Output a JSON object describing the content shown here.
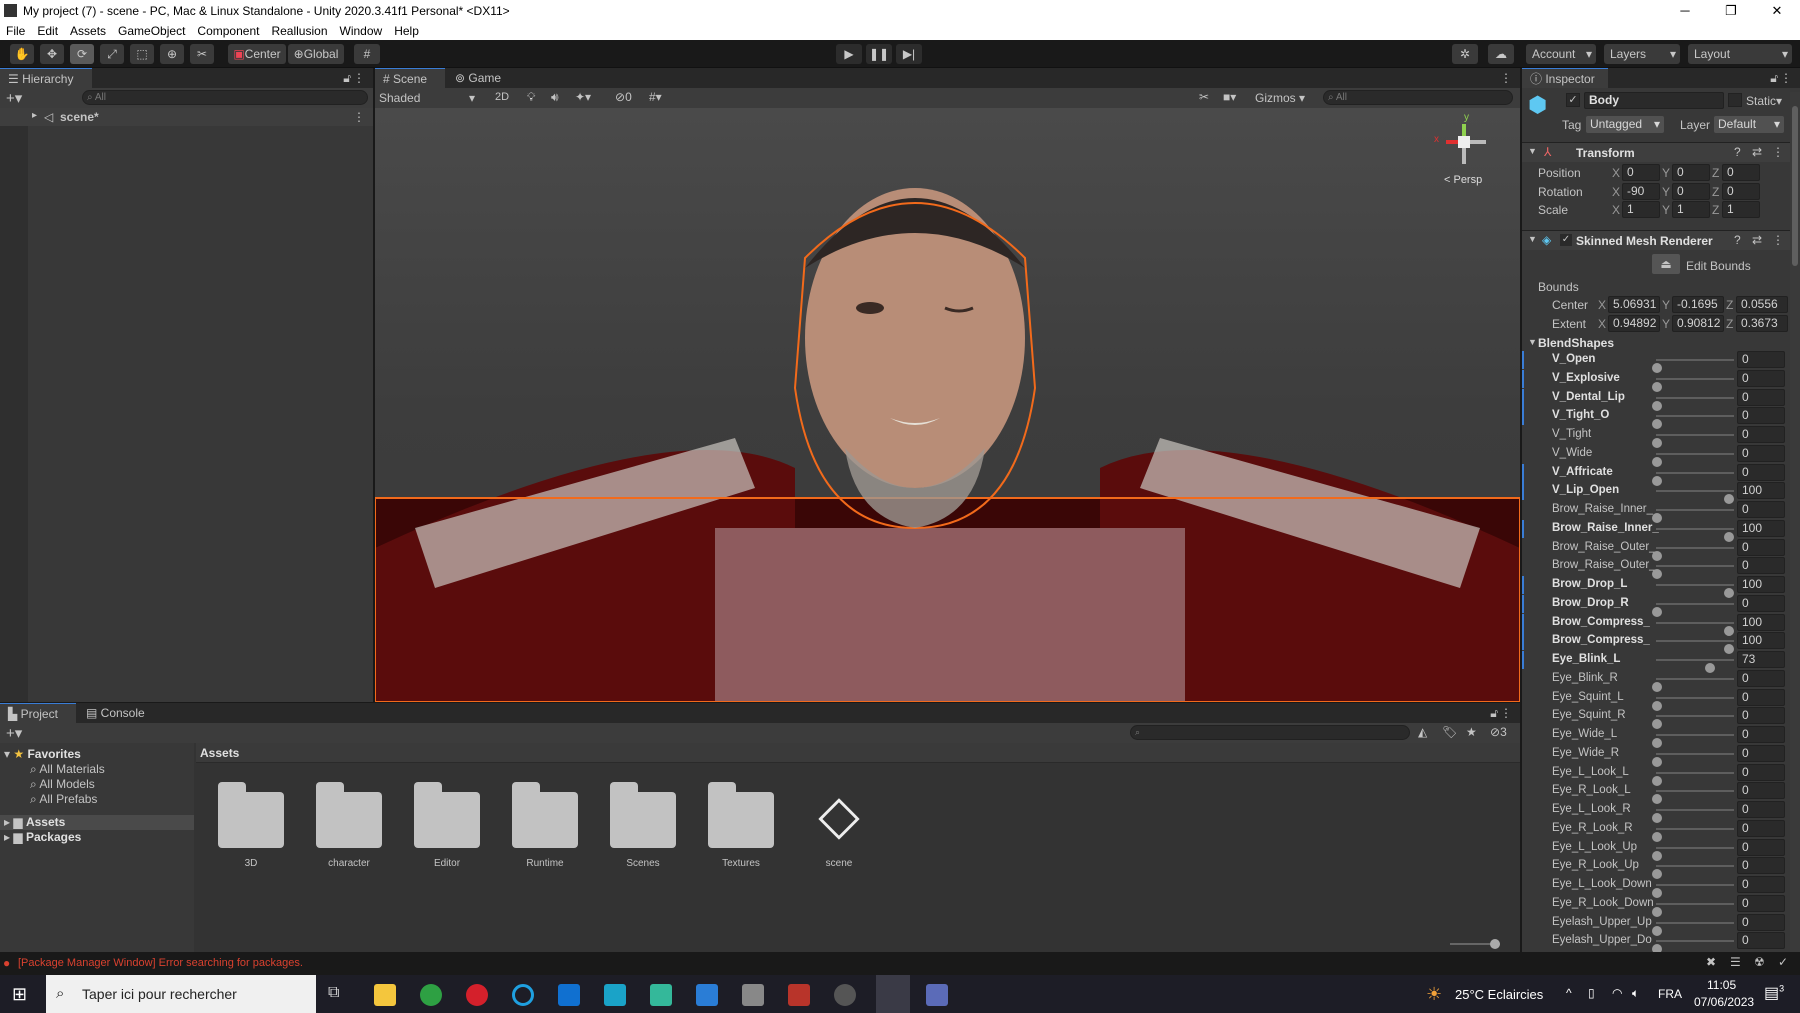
{
  "window": {
    "title": "My project (7) - scene - PC, Mac & Linux Standalone - Unity 2020.3.41f1 Personal* <DX11>"
  },
  "menu": [
    "File",
    "Edit",
    "Assets",
    "GameObject",
    "Component",
    "Reallusion",
    "Window",
    "Help"
  ],
  "toolbar": {
    "center": "Center",
    "global": "Global",
    "account": "Account",
    "layers": "Layers",
    "layout": "Layout"
  },
  "hierarchy": {
    "tab": "Hierarchy",
    "search_placeholder": "All",
    "scene": "scene*"
  },
  "scene": {
    "tabs": [
      "Scene",
      "Game"
    ],
    "shading": "Shaded",
    "mode2d": "2D",
    "hidden_count": "0",
    "gizmos": "Gizmos",
    "search_placeholder": "All",
    "persp": "< Persp",
    "axis_x": "x",
    "axis_y": "y"
  },
  "inspector": {
    "tab": "Inspector",
    "name": "Body",
    "static": "Static",
    "tag_label": "Tag",
    "tag": "Untagged",
    "layer_label": "Layer",
    "layer": "Default",
    "transform": {
      "title": "Transform",
      "rows": [
        {
          "label": "Position",
          "x": "0",
          "y": "0",
          "z": "0"
        },
        {
          "label": "Rotation",
          "x": "-90",
          "y": "0",
          "z": "0"
        },
        {
          "label": "Scale",
          "x": "1",
          "y": "1",
          "z": "1"
        }
      ]
    },
    "smr": {
      "title": "Skinned Mesh Renderer",
      "edit_bounds": "Edit Bounds",
      "bounds": "Bounds",
      "center": {
        "label": "Center",
        "x": "5.06931",
        "y": "-0.1695",
        "z": "0.0556"
      },
      "extent": {
        "label": "Extent",
        "x": "0.94892",
        "y": "0.90812",
        "z": "0.3673"
      }
    },
    "blendshapes_title": "BlendShapes",
    "blendshapes": [
      {
        "name": "V_Open",
        "value": 0,
        "modified": true
      },
      {
        "name": "V_Explosive",
        "value": 0,
        "modified": true
      },
      {
        "name": "V_Dental_Lip",
        "value": 0,
        "modified": true
      },
      {
        "name": "V_Tight_O",
        "value": 0,
        "modified": true
      },
      {
        "name": "V_Tight",
        "value": 0,
        "modified": false
      },
      {
        "name": "V_Wide",
        "value": 0,
        "modified": false
      },
      {
        "name": "V_Affricate",
        "value": 0,
        "modified": true
      },
      {
        "name": "V_Lip_Open",
        "value": 100,
        "modified": true
      },
      {
        "name": "Brow_Raise_Inner_",
        "value": 0,
        "modified": false
      },
      {
        "name": "Brow_Raise_Inner_",
        "value": 100,
        "modified": true
      },
      {
        "name": "Brow_Raise_Outer_",
        "value": 0,
        "modified": false
      },
      {
        "name": "Brow_Raise_Outer_",
        "value": 0,
        "modified": false
      },
      {
        "name": "Brow_Drop_L",
        "value": 100,
        "modified": true
      },
      {
        "name": "Brow_Drop_R",
        "value": 0,
        "modified": true
      },
      {
        "name": "Brow_Compress_",
        "value": 100,
        "modified": true
      },
      {
        "name": "Brow_Compress_",
        "value": 100,
        "modified": true
      },
      {
        "name": "Eye_Blink_L",
        "value": 73,
        "modified": true
      },
      {
        "name": "Eye_Blink_R",
        "value": 0,
        "modified": false
      },
      {
        "name": "Eye_Squint_L",
        "value": 0,
        "modified": false
      },
      {
        "name": "Eye_Squint_R",
        "value": 0,
        "modified": false
      },
      {
        "name": "Eye_Wide_L",
        "value": 0,
        "modified": false
      },
      {
        "name": "Eye_Wide_R",
        "value": 0,
        "modified": false
      },
      {
        "name": "Eye_L_Look_L",
        "value": 0,
        "modified": false
      },
      {
        "name": "Eye_R_Look_L",
        "value": 0,
        "modified": false
      },
      {
        "name": "Eye_L_Look_R",
        "value": 0,
        "modified": false
      },
      {
        "name": "Eye_R_Look_R",
        "value": 0,
        "modified": false
      },
      {
        "name": "Eye_L_Look_Up",
        "value": 0,
        "modified": false
      },
      {
        "name": "Eye_R_Look_Up",
        "value": 0,
        "modified": false
      },
      {
        "name": "Eye_L_Look_Down",
        "value": 0,
        "modified": false
      },
      {
        "name": "Eye_R_Look_Down",
        "value": 0,
        "modified": false
      },
      {
        "name": "Eyelash_Upper_Up",
        "value": 0,
        "modified": false
      },
      {
        "name": "Eyelash_Upper_Do",
        "value": 0,
        "modified": false
      }
    ]
  },
  "project": {
    "tabs": [
      "Project",
      "Console"
    ],
    "favorites": "Favorites",
    "fav_items": [
      "All Materials",
      "All Models",
      "All Prefabs"
    ],
    "roots": [
      "Assets",
      "Packages"
    ],
    "breadcrumb": "Assets",
    "hidden_count": "3",
    "items": [
      "3D",
      "character",
      "Editor",
      "Runtime",
      "Scenes",
      "Textures",
      "scene"
    ]
  },
  "status": {
    "error": "[Package Manager Window] Error searching for packages."
  },
  "taskbar": {
    "search": "Taper ici pour rechercher",
    "weather": "25°C  Eclaircies",
    "lang": "FRA",
    "time": "11:05",
    "date": "07/06/2023",
    "notifications": "3"
  },
  "colors": {
    "accent": "#3a7dd6",
    "selection": "#f26a1b",
    "error": "#d9412f"
  }
}
